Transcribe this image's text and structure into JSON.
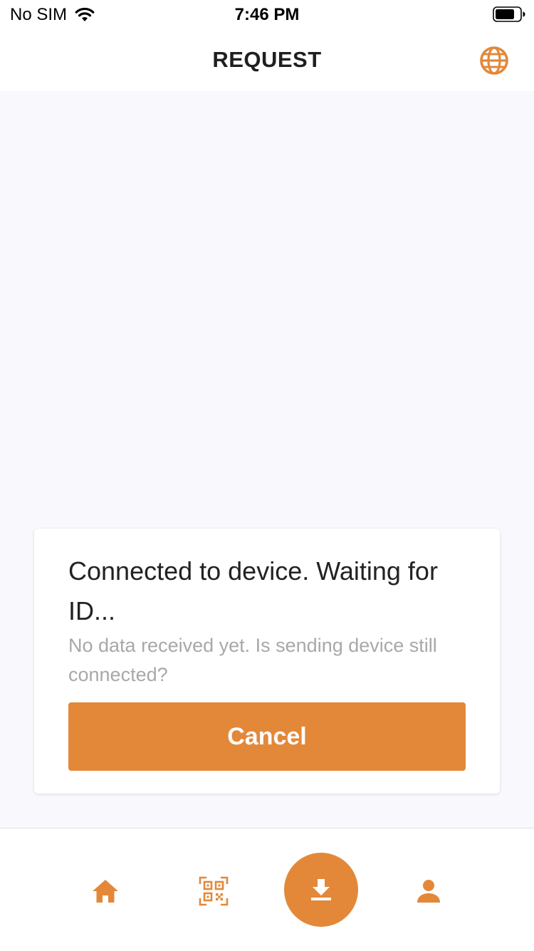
{
  "status_bar": {
    "carrier": "No SIM",
    "time": "7:46 PM"
  },
  "header": {
    "title": "REQUEST",
    "language_icon": "globe-icon"
  },
  "card": {
    "title": "Connected to device. Waiting for ID...",
    "subtitle": "No data received yet. Is sending device still connected?",
    "cancel_label": "Cancel"
  },
  "tab_bar": {
    "items": [
      {
        "icon": "home-icon",
        "active": false
      },
      {
        "icon": "qr-code-icon",
        "active": false
      },
      {
        "icon": "download-icon",
        "active": true
      },
      {
        "icon": "person-icon",
        "active": false
      }
    ]
  },
  "colors": {
    "accent": "#e38839",
    "background": "#f8f8fd",
    "muted_text": "#a8a8a8"
  }
}
